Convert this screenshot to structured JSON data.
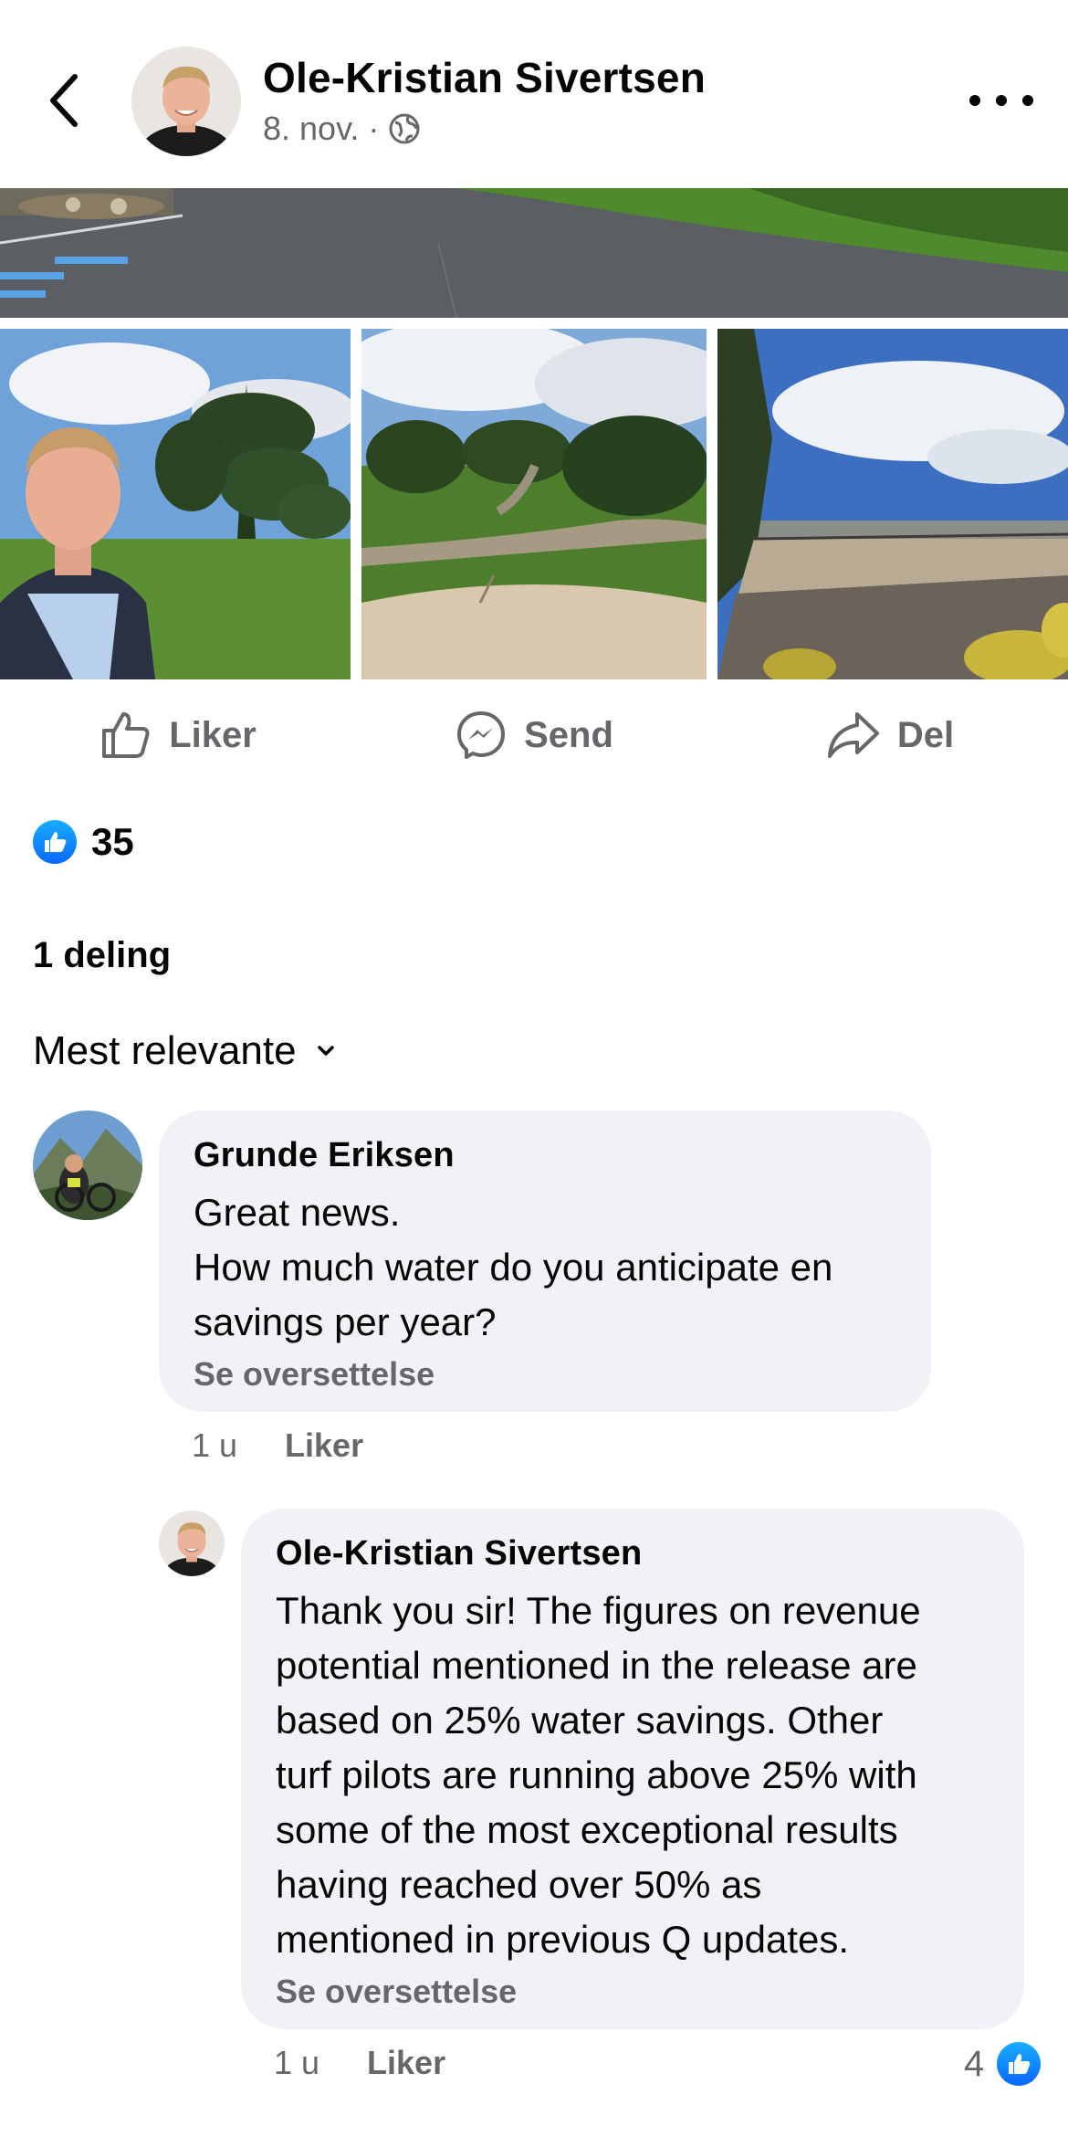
{
  "post": {
    "author": "Ole-Kristian Sivertsen",
    "date": "8. nov.",
    "separator": "·",
    "visibility_icon": "globe-icon"
  },
  "actions": {
    "like_label": "Liker",
    "send_label": "Send",
    "share_label": "Del"
  },
  "reactions": {
    "count": "35"
  },
  "shares": "1 deling",
  "sort": {
    "label": "Mest relevante"
  },
  "comments": [
    {
      "author": "Grunde Eriksen",
      "lines": [
        "Great news.",
        "How much water do you anticipate en",
        "savings per year?"
      ],
      "translate": "Se oversettelse",
      "time": "1 u",
      "like": "Liker"
    },
    {
      "author": "Ole-Kristian Sivertsen",
      "lines": [
        "Thank you sir! The figures on revenue",
        "potential mentioned in the release are",
        "based on 25% water savings. Other",
        "turf pilots are running above 25% with",
        "some of the most exceptional results",
        "having reached over 50% as",
        "mentioned in previous Q updates."
      ],
      "translate": "Se oversettelse",
      "time": "1 u",
      "like": "Liker",
      "reaction_count": "4"
    }
  ],
  "colors": {
    "accent": "#0866ff",
    "secondary_text": "#65676b",
    "bubble": "#f0f2f5"
  }
}
